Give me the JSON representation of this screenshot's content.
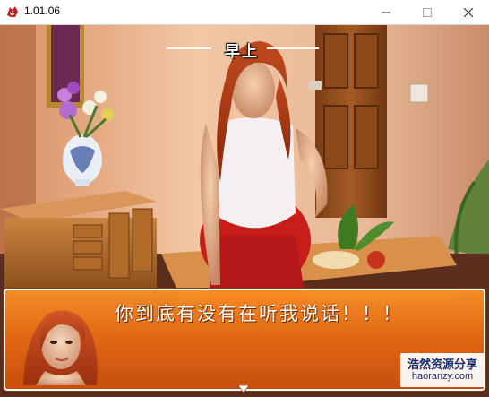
{
  "window": {
    "title": "1.01.06",
    "icon": "game-dragon-icon",
    "buttons": [
      "minimize-icon",
      "maximize-icon",
      "close-icon"
    ]
  },
  "scene": {
    "period_label": "早上",
    "setting": "living room with flower vase, wooden cabinet, door and table",
    "character": "red-haired woman in white tank top and red skirt"
  },
  "dialogue": {
    "text": "你到底有没有在听我说话！！！",
    "portrait": "red-haired woman portrait",
    "continue_indicator": "triangle-down-icon"
  },
  "watermark": {
    "line1": "浩然资源分享",
    "line2": "haoranzy.com"
  },
  "colors": {
    "dialogue_top": "#ff9628",
    "dialogue_bottom": "#cd500c",
    "text": "#ffffff",
    "watermark_text": "#1a2f6e"
  }
}
